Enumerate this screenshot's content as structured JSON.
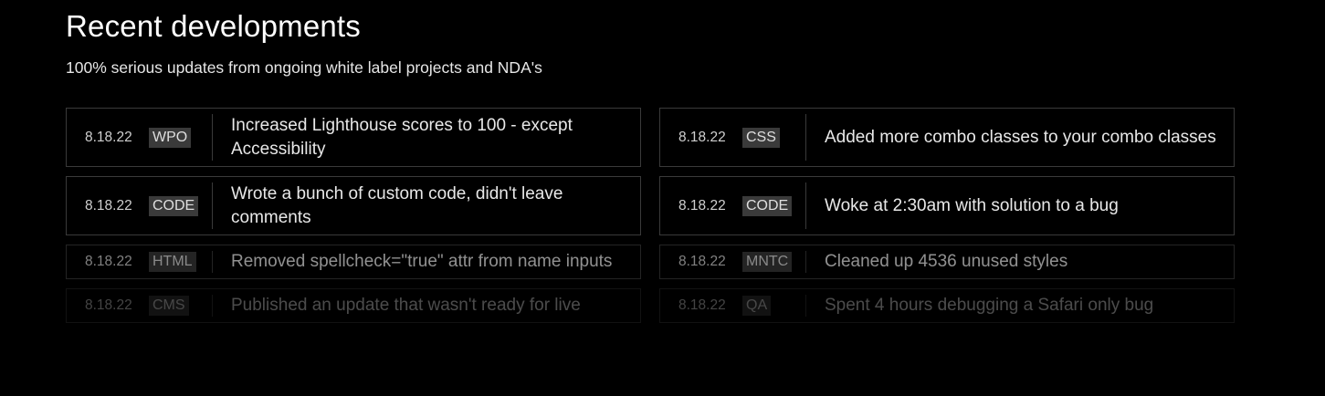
{
  "header": {
    "title": "Recent developments",
    "subtitle": "100% serious updates from ongoing white label projects and NDA's"
  },
  "updates": [
    {
      "date": "8.18.22",
      "tag": "WPO",
      "text": "Increased Lighthouse scores to 100 - except Accessibility"
    },
    {
      "date": "8.18.22",
      "tag": "CSS",
      "text": "Added more combo classes to your combo classes"
    },
    {
      "date": "8.18.22",
      "tag": "CODE",
      "text": "Wrote a bunch of custom code, didn't leave comments"
    },
    {
      "date": "8.18.22",
      "tag": "CODE",
      "text": "Woke at 2:30am with solution to a bug"
    },
    {
      "date": "8.18.22",
      "tag": "HTML",
      "text": "Removed spellcheck=\"true\" attr from name inputs"
    },
    {
      "date": "8.18.22",
      "tag": "MNTC",
      "text": "Cleaned up 4536 unused styles"
    },
    {
      "date": "8.18.22",
      "tag": "CMS",
      "text": "Published an update that wasn't ready for live"
    },
    {
      "date": "8.18.22",
      "tag": "QA",
      "text": "Spent 4 hours debugging a Safari only bug"
    }
  ],
  "colors": {
    "background": "#000000",
    "border": "#3a3a3a",
    "tag_background": "#3a3a3a",
    "text": "#ffffff"
  }
}
